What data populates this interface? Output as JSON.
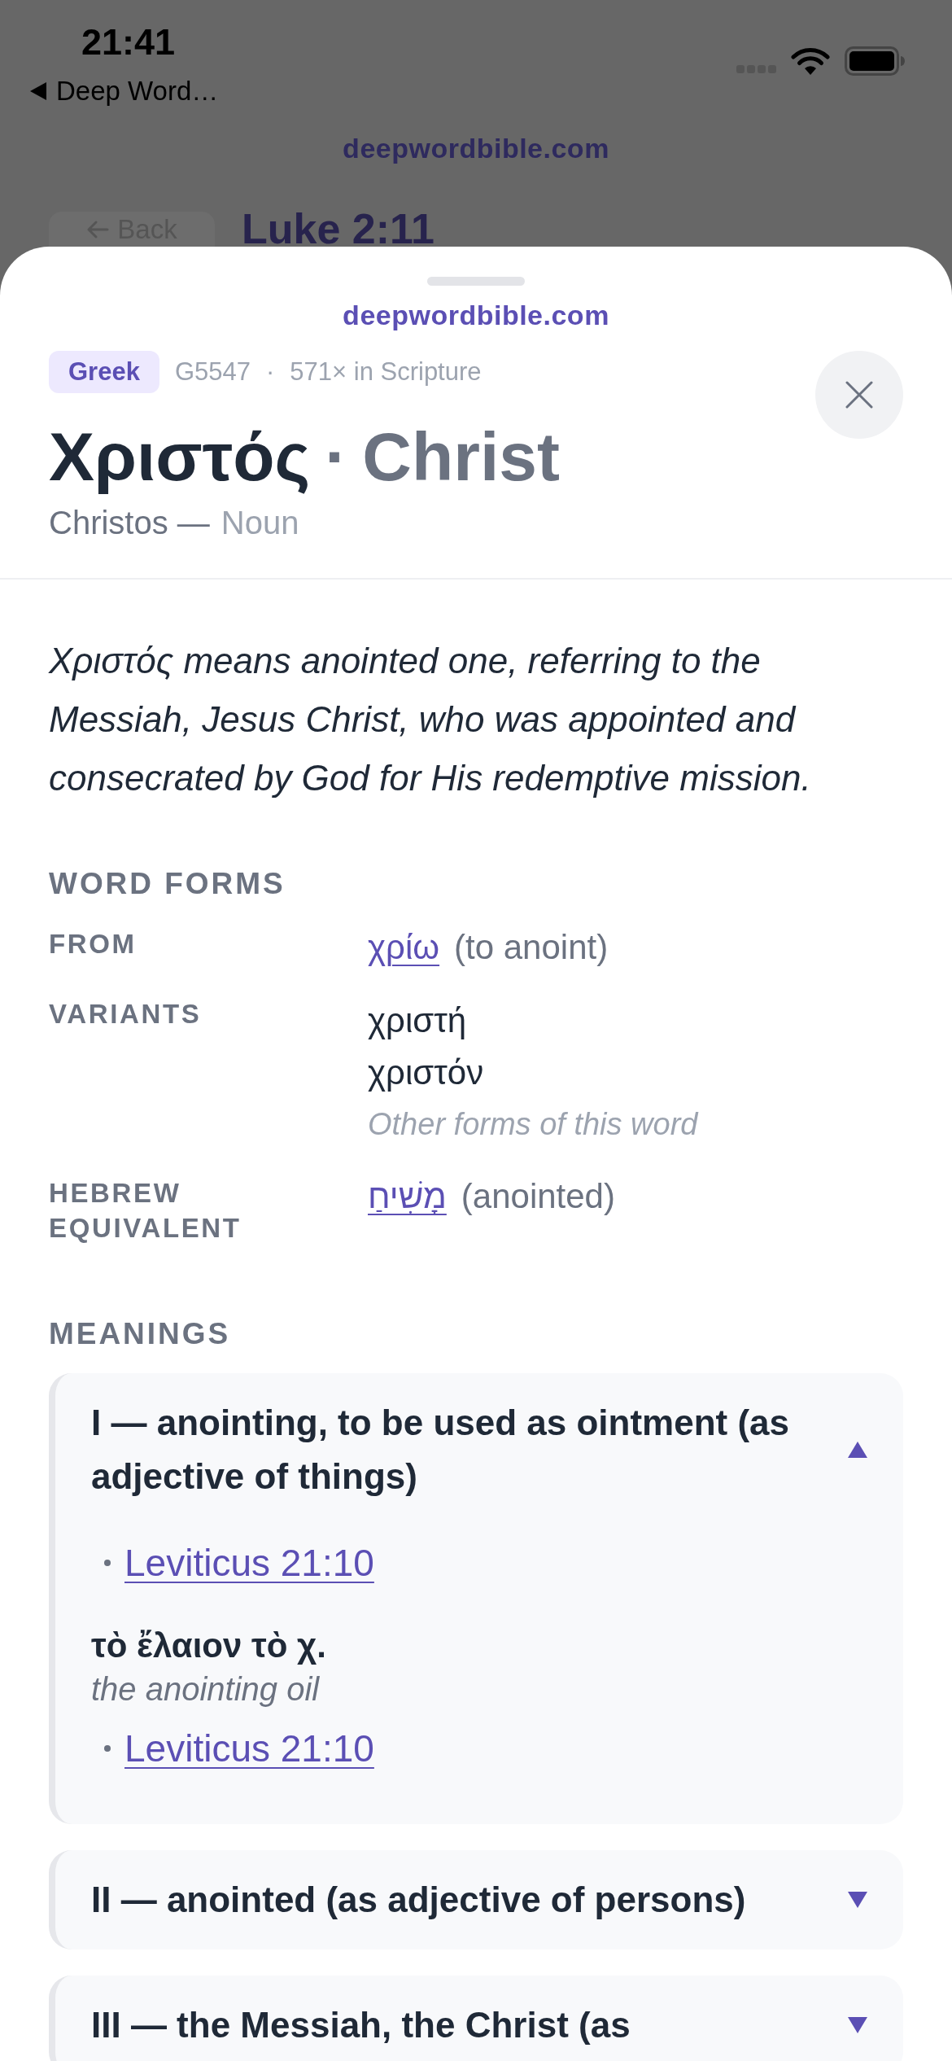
{
  "status_bar": {
    "time": "21:41",
    "back_label": "Deep Word…"
  },
  "background_page": {
    "site": "deepwordbible.com",
    "back_button": "Back",
    "title": "Luke 2:11"
  },
  "sheet": {
    "site": "deepwordbible.com",
    "language": "Greek",
    "strongs_number": "G5547",
    "separator": "·",
    "occurrences": "571× in Scripture",
    "lemma": "Χριστός",
    "title_separator": "·",
    "gloss": "Christ",
    "transliteration": "Christos —",
    "part_of_speech": "Noun",
    "definition": "Χριστός means anointed one, referring to the Messiah, Jesus Christ, who was appointed and consecrated by God for His redemptive mission."
  },
  "word_forms": {
    "heading": "WORD FORMS",
    "rows": [
      {
        "kind": "link",
        "label": "FROM",
        "link": "χρίω",
        "note": "(to anoint)"
      },
      {
        "kind": "list",
        "label": "VARIANTS",
        "items": [
          "χριστή",
          "χριστόν"
        ],
        "note": "Other forms of this word"
      },
      {
        "kind": "link",
        "label": "HEBREW EQUIVALENT",
        "link": "מָשִׁיחַ",
        "note": "(anointed)"
      }
    ]
  },
  "meanings": {
    "heading": "MEANINGS",
    "items": [
      {
        "title": "I — anointing, to be used as ointment (as adjective of things)",
        "expanded": true,
        "entries": [
          {
            "kind": "reference",
            "text": "Leviticus 21:10"
          },
          {
            "kind": "phrase",
            "greek": "τὸ ἔλαιον τὸ χ.",
            "translation": "the anointing oil"
          },
          {
            "kind": "reference",
            "text": "Leviticus 21:10"
          }
        ]
      },
      {
        "title": "II — anointed (as adjective of persons)",
        "expanded": false
      },
      {
        "title": "III — the Messiah, the Christ (as",
        "expanded": false
      }
    ]
  }
}
